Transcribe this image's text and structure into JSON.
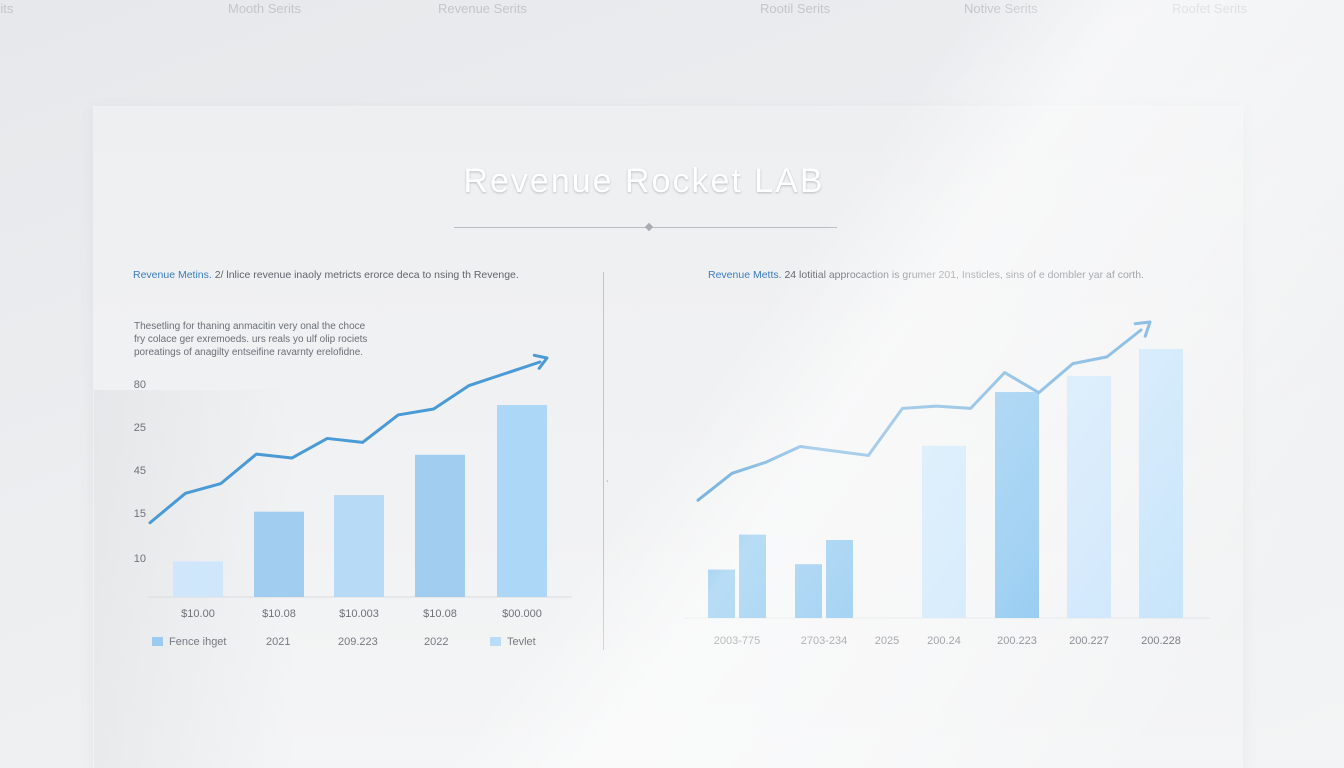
{
  "top_tabs": [
    "rits",
    "Mooth Serits",
    "Revenue Serits",
    "Rootil Serits",
    "Notive Serits",
    "Roofet Serits"
  ],
  "title": "Revenue Rocket LAB",
  "left_panel": {
    "desc_lead": "Revenue Metins.",
    "desc_rest": " 2/ lnlice revenue inaoly metricts erorce deca to nsing th Revenge.",
    "note_lines": [
      "Thesetling for thaning anmacitin very onal the choce",
      "fry colace ger exremoeds. urs reals yo ulf olip rociets",
      "poreatings of anagilty entseifine ravarnty erelofidne."
    ]
  },
  "right_panel": {
    "desc_lead": "Revenue Metts.",
    "desc_rest": " 24 lotitial approcaction is grumer 201, Insticles, sins of e dombler yar af corth."
  },
  "divider_mark": "ˎ",
  "legend": {
    "items": [
      {
        "label": "Fence ihget",
        "color": "#9ccaf0"
      },
      {
        "label": "2021",
        "color": ""
      },
      {
        "label": "209.223",
        "color": ""
      },
      {
        "label": "2022",
        "color": ""
      },
      {
        "label": "Tevlet",
        "color": "#b9dcf8"
      }
    ]
  },
  "colors": {
    "line": "#4a9ad6",
    "bar_dark": "#5aaee8",
    "bar_light": "#bfe0fa",
    "bar_mid": "#9ccaf0"
  },
  "chart_data": [
    {
      "type": "bar",
      "title": "",
      "y_tick_labels": [
        "80",
        "25",
        "45",
        "15",
        "10"
      ],
      "categories": [
        "$10.00",
        "$10.08",
        "$10.003",
        "$10.08",
        "$00.000"
      ],
      "bar_values": [
        0.15,
        0.36,
        0.43,
        0.6,
        0.81
      ],
      "bar_colors": [
        "#cde6fb",
        "#9ccaf0",
        "#b3d9f6",
        "#9ccaf0",
        "#a9d5f5"
      ],
      "trend_line": [
        0.18,
        0.33,
        0.38,
        0.53,
        0.51,
        0.61,
        0.59,
        0.73,
        0.76,
        0.88,
        0.94,
        1.0
      ],
      "trend_arrow": true
    },
    {
      "type": "bar",
      "title": "",
      "categories": [
        "2003-775",
        "2703-234",
        "2025",
        "200.24",
        "200.223",
        "200.227",
        "200.228"
      ],
      "bar_groups": [
        [
          0.18,
          0.31
        ],
        [
          0.2,
          0.29
        ],
        [],
        [
          0.64
        ],
        [
          0.84
        ],
        [
          0.9
        ],
        [
          1.0
        ]
      ],
      "bar_colors": [
        [
          "#5aaee8",
          "#5aaee8"
        ],
        [
          "#5aaee8",
          "#5aaee8"
        ],
        [],
        [
          "#bfe0fa"
        ],
        [
          "#6ab6ec"
        ],
        [
          "#c4e2fb"
        ],
        [
          "#bfe0fa"
        ]
      ],
      "trend_line": [
        0.24,
        0.36,
        0.41,
        0.48,
        0.46,
        0.44,
        0.65,
        0.66,
        0.65,
        0.81,
        0.72,
        0.85,
        0.88,
        1.0
      ],
      "trend_arrow": true
    }
  ]
}
